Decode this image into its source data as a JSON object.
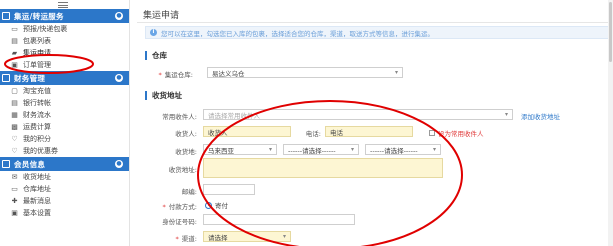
{
  "sidebar": {
    "sections": [
      {
        "title": "集运/转运服务",
        "items": [
          {
            "label": "预报/快递包裹",
            "icon": "package-icon"
          },
          {
            "label": "包裹列表",
            "icon": "list-icon"
          },
          {
            "label": "集运申请",
            "icon": "truck-icon"
          },
          {
            "label": "订单管理",
            "icon": "order-icon"
          }
        ]
      },
      {
        "title": "财务管理",
        "items": [
          {
            "label": "淘宝充值",
            "icon": "recharge-icon"
          },
          {
            "label": "银行转帐",
            "icon": "bank-icon"
          },
          {
            "label": "财务流水",
            "icon": "ledger-icon"
          },
          {
            "label": "运费计算",
            "icon": "calculator-icon"
          },
          {
            "label": "我的积分",
            "icon": "points-icon"
          },
          {
            "label": "我的优惠券",
            "icon": "coupon-icon"
          }
        ]
      },
      {
        "title": "会员信息",
        "items": [
          {
            "label": "收货地址",
            "icon": "location-icon"
          },
          {
            "label": "仓库地址",
            "icon": "warehouse-icon"
          },
          {
            "label": "最新消息",
            "icon": "message-icon"
          },
          {
            "label": "基本设置",
            "icon": "settings-icon"
          }
        ]
      }
    ]
  },
  "main": {
    "title": "集运申请",
    "notice": "您可以在这里，勾选您已入库的包裹，选择适合您的仓库，渠道，取送方式等信息，进行集运。",
    "warehouse_section": "仓库",
    "warehouse_label": "集运仓库:",
    "warehouse_value": "易达义乌仓",
    "address_section": "收货地址",
    "common_receiver_label": "常用收件人:",
    "common_receiver_placeholder": "请选择常用收件人",
    "add_address_link": "添加收货地址",
    "receiver_label": "收货人:",
    "receiver_value": "收货人",
    "phone_label": "电话:",
    "phone_value": "电话",
    "set_common_label": "设为常用收件人",
    "region_label": "收货地:",
    "region_country": "马来西亚",
    "region_state": "------请选择------",
    "region_city": "------请选择------",
    "detail_label": "收货地址:",
    "postcode_label": "邮编:",
    "payment_label": "付款方式:",
    "payment_option": "寄付",
    "id_label": "身份证号码:",
    "channel_label": "渠道:",
    "channel_value": "请选择"
  },
  "colors": {
    "brand": "#2c77c9",
    "annotation": "#e00000",
    "highlight_field": "#fdf6d3"
  }
}
